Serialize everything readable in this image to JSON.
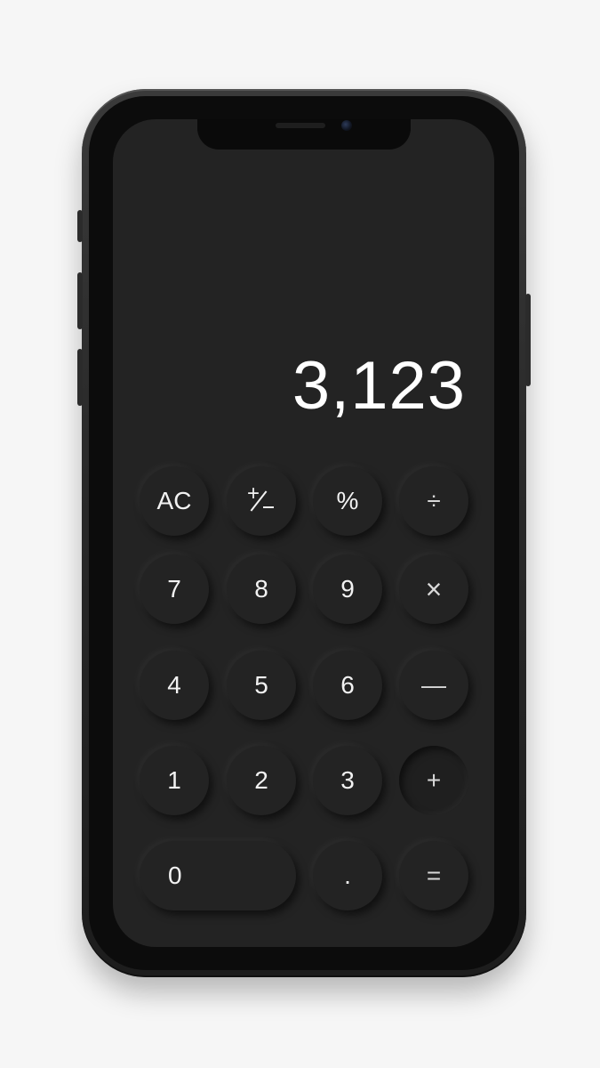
{
  "calculator": {
    "display_value": "3,123",
    "keys": {
      "ac": "AC",
      "percent": "%",
      "divide": "÷",
      "seven": "7",
      "eight": "8",
      "nine": "9",
      "multiply": "×",
      "four": "4",
      "five": "5",
      "six": "6",
      "minus": "—",
      "one": "1",
      "two": "2",
      "three": "3",
      "plus": "+",
      "zero": "0",
      "dot": ".",
      "equals": "="
    },
    "plus_minus_icon": "plus-minus-icon",
    "active_operator": "plus"
  },
  "colors": {
    "background": "#f6f6f6",
    "screen": "#232323",
    "key_text": "#f2f2f2",
    "display_text": "#ffffff"
  }
}
